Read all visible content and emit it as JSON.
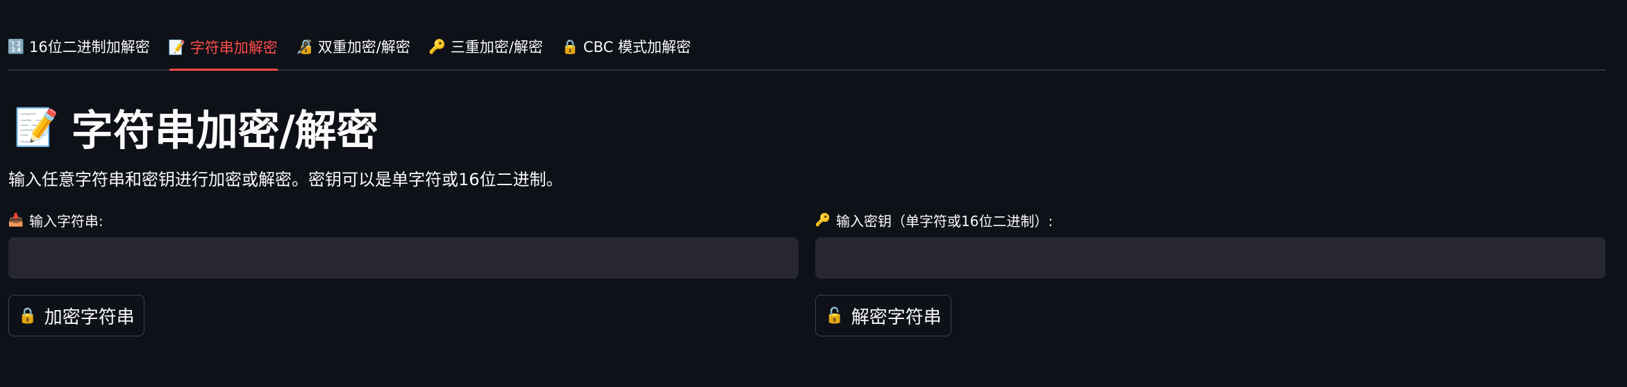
{
  "tabs": [
    {
      "icon": "🔢",
      "icon_name": "numbers-icon",
      "label": "16位二进制加解密",
      "active": false
    },
    {
      "icon": "📝",
      "icon_name": "memo-icon",
      "label": "字符串加解密",
      "active": true
    },
    {
      "icon": "🔏",
      "icon_name": "lock-with-pen-icon",
      "label": "双重加密/解密",
      "active": false
    },
    {
      "icon": "🔑",
      "icon_name": "key-icon",
      "label": "三重加密/解密",
      "active": false
    },
    {
      "icon": "🔒",
      "icon_name": "lock-icon",
      "label": "CBC 模式加解密",
      "active": false
    }
  ],
  "page": {
    "title_icon": "📝",
    "title": "字符串加密/解密",
    "description": "输入任意字符串和密钥进行加密或解密。密钥可以是单字符或16位二进制。"
  },
  "string_input": {
    "icon": "📥",
    "label": "输入字符串:",
    "value": "",
    "placeholder": ""
  },
  "key_input": {
    "icon": "🔑",
    "label": "输入密钥（单字符或16位二进制）:",
    "value": "",
    "placeholder": ""
  },
  "encrypt_button": {
    "icon": "🔒",
    "label": "加密字符串"
  },
  "decrypt_button": {
    "icon": "🔓",
    "label": "解密字符串"
  },
  "colors": {
    "background": "#0e1117",
    "accent": "#ff4b4b",
    "input_bg": "#262730",
    "text": "#fafafa"
  }
}
